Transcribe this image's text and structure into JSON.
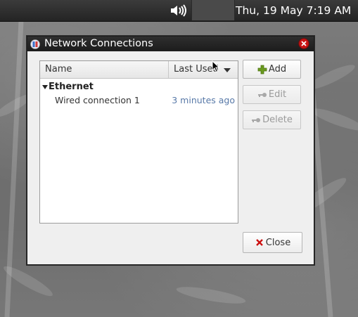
{
  "panel": {
    "clock": "Thu, 19 May  7:19 AM",
    "volume_icon": "speaker-volume-icon"
  },
  "window": {
    "title": "Network Connections",
    "title_icon": "network-manager-icon",
    "close_icon": "window-close-icon"
  },
  "list": {
    "columns": {
      "name": "Name",
      "last_used": "Last Used"
    },
    "groups": [
      {
        "label": "Ethernet",
        "connections": [
          {
            "name": "Wired connection 1",
            "last_used": "3 minutes ago"
          }
        ]
      }
    ]
  },
  "buttons": {
    "add": "Add",
    "edit": "Edit",
    "delete": "Delete",
    "close": "Close"
  },
  "colors": {
    "add_icon": "#6a9a1f",
    "close_icon": "#cc1111",
    "last_used_text": "#5879a8"
  }
}
